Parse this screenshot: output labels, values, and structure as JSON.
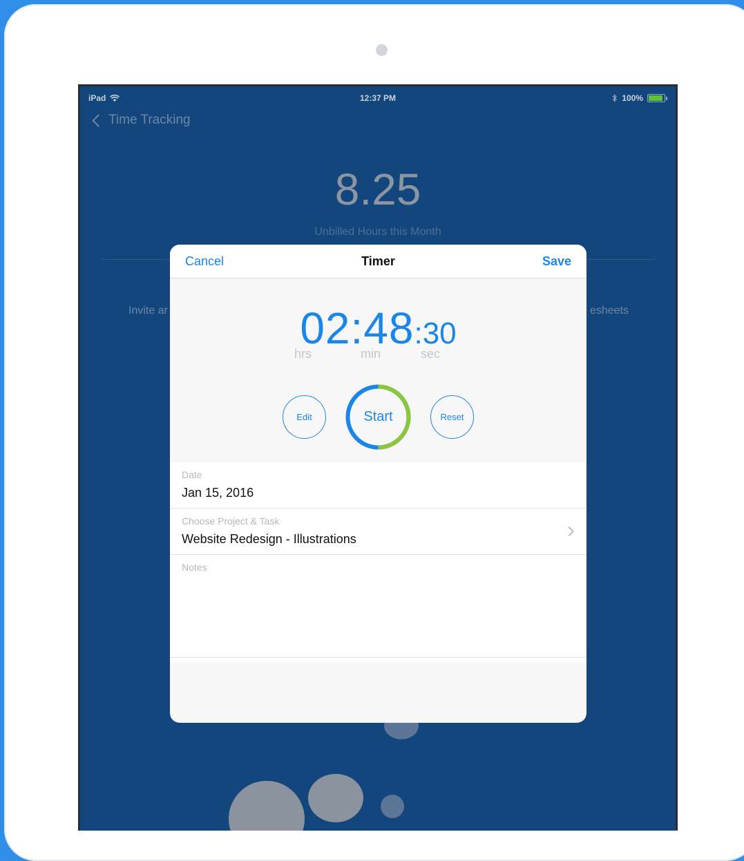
{
  "status_bar": {
    "device": "iPad",
    "time": "12:37 PM",
    "battery": "100%"
  },
  "nav": {
    "back_label": "Time Tracking"
  },
  "background": {
    "big_number": "8.25",
    "big_number_label": "Unbilled Hours this Month",
    "left_text": "Invite ar",
    "right_text": "esheets"
  },
  "modal": {
    "cancel": "Cancel",
    "title": "Timer",
    "save": "Save",
    "timer": {
      "hours_minutes": "02:48",
      "seconds": ":30",
      "hrs_label": "hrs",
      "min_label": "min",
      "sec_label": "sec"
    },
    "buttons": {
      "edit": "Edit",
      "start": "Start",
      "reset": "Reset"
    },
    "progress_fraction": 0.5,
    "colors": {
      "accent": "#1A86EA",
      "progress": "#8CC63F"
    },
    "fields": {
      "date_label": "Date",
      "date_value": "Jan 15, 2016",
      "project_label": "Choose Project & Task",
      "project_value": "Website Redesign - Illustrations",
      "notes_label": "Notes"
    }
  }
}
